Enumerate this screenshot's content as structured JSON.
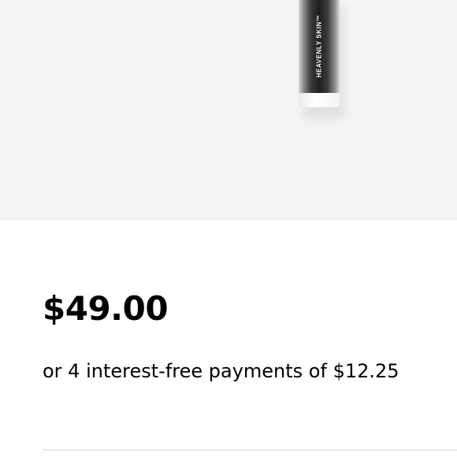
{
  "product": {
    "brand_label": "HEAVENLY SKIN™",
    "price": "$49.00",
    "installments_text": "or 4 interest-free payments of $12.25"
  },
  "colors": {
    "image_background": "#f5f5f5",
    "text": "#000000",
    "divider": "#e6e6e6"
  }
}
